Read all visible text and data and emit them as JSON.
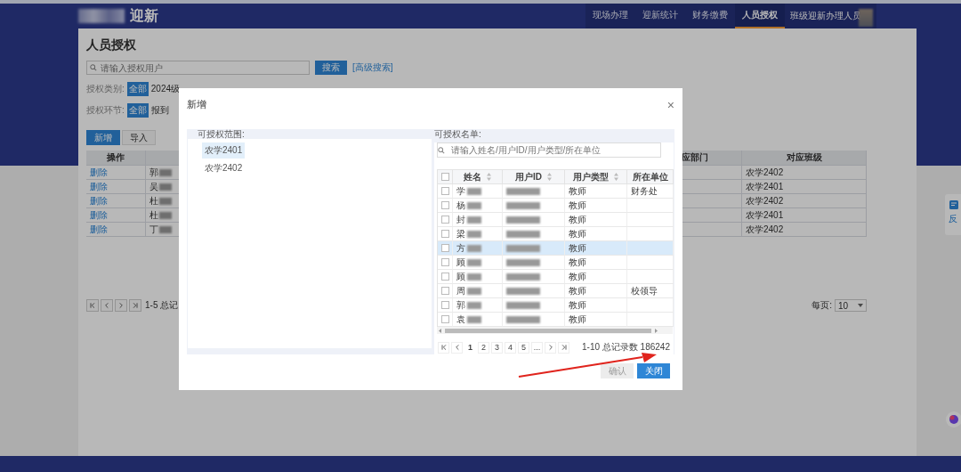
{
  "header": {
    "logo_text": "迎新",
    "nav": [
      {
        "label": "现场办理",
        "selected": false
      },
      {
        "label": "迎新统计",
        "selected": false
      },
      {
        "label": "财务缴费",
        "selected": false
      },
      {
        "label": "人员授权",
        "selected": true
      }
    ],
    "user": "班级迎新办理人员"
  },
  "page": {
    "title": "人员授权",
    "search": {
      "placeholder": "请输入授权用户"
    },
    "search_button": "搜索",
    "advanced_link": "[高级搜索]",
    "filters": [
      {
        "label": "授权类别:",
        "tag": "全部",
        "value": "2024级"
      },
      {
        "label": "授权环节:",
        "tag": "全部",
        "value": "报到"
      }
    ],
    "buttons": [
      {
        "label": "新增",
        "kind": "primary"
      },
      {
        "label": "导入",
        "kind": "default"
      }
    ],
    "table": {
      "columns": [
        "操作",
        "应部门",
        "对应班级"
      ],
      "rows": [
        {
          "action": "删除",
          "name": "郭",
          "class": "农学2402"
        },
        {
          "action": "删除",
          "name": "吴",
          "class": "农学2401"
        },
        {
          "action": "删除",
          "name": "杜",
          "class": "农学2402"
        },
        {
          "action": "删除",
          "name": "杜",
          "class": "农学2401"
        },
        {
          "action": "删除",
          "name": "丁",
          "class": "农学2402"
        }
      ]
    },
    "pagination": {
      "summary": "1-5 总记",
      "per_page_label": "每页:",
      "per_page": "10"
    },
    "feedback": "反"
  },
  "dialog": {
    "title": "新增",
    "close": "×",
    "scope_label": "可授权范围:",
    "scope_items": [
      {
        "label": "农学2401",
        "selected": true
      },
      {
        "label": "农学2402",
        "selected": false
      }
    ],
    "list_label": "可授权名单:",
    "search": {
      "placeholder": "请输入姓名/用户ID/用户类型/所在单位"
    },
    "select_all": {
      "checked": false
    },
    "columns": [
      "姓名",
      "用户ID",
      "用户类型",
      "所在单位"
    ],
    "rows": [
      {
        "name": "学",
        "type": "教师",
        "unit": "财务处",
        "selected": false,
        "checked": false
      },
      {
        "name": "杨",
        "type": "教师",
        "selected": false,
        "checked": false
      },
      {
        "name": "封",
        "type": "教师",
        "selected": false,
        "checked": false
      },
      {
        "name": "梁",
        "type": "教师",
        "selected": false,
        "checked": false
      },
      {
        "name": "方",
        "type": "教师",
        "selected": true,
        "checked": false
      },
      {
        "name": "顾",
        "type": "教师",
        "selected": false,
        "checked": false
      },
      {
        "name": "顾",
        "type": "教师",
        "selected": false,
        "checked": false
      },
      {
        "name": "周",
        "type": "教师",
        "unit": "校领导",
        "selected": false,
        "checked": false
      },
      {
        "name": "郭",
        "type": "教师",
        "selected": false,
        "checked": false
      },
      {
        "name": "袁",
        "type": "教师",
        "selected": false,
        "checked": false
      }
    ],
    "pager": {
      "pages": [
        {
          "label": "1",
          "selected": true
        },
        {
          "label": "2",
          "selected": false
        },
        {
          "label": "3",
          "selected": false
        },
        {
          "label": "4",
          "selected": false
        },
        {
          "label": "5",
          "selected": false
        },
        {
          "label": "...",
          "selected": false
        }
      ],
      "summary": "1-10 总记录数 186242"
    },
    "buttons": [
      {
        "label": "确认",
        "disabled": true
      },
      {
        "label": "关闭",
        "disabled": false
      }
    ]
  }
}
